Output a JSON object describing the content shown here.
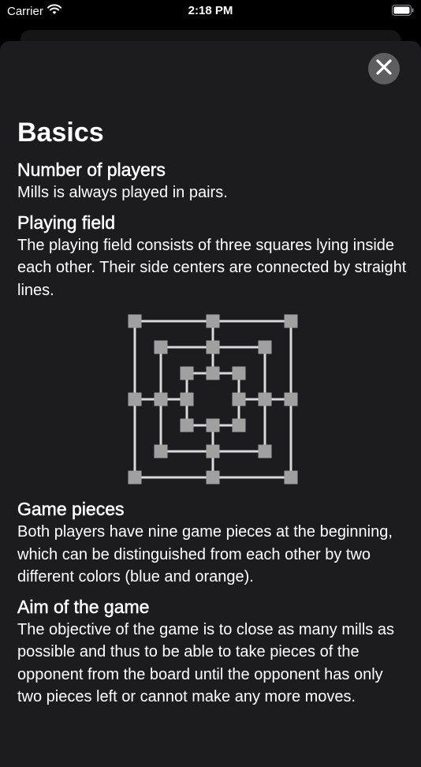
{
  "status_bar": {
    "carrier": "Carrier",
    "time": "2:18 PM"
  },
  "sheet": {
    "title": "Basics",
    "sections": [
      {
        "heading": "Number of players",
        "body": "Mills is always played in pairs."
      },
      {
        "heading": "Playing field",
        "body": "The playing field consists of three squares lying inside each other. Their side centers are connected by straight lines."
      },
      {
        "heading": "Game pieces",
        "body": "Both players have nine game pieces at the beginning, which can be distinguished from each other by two different colors (blue and orange)."
      },
      {
        "heading": "Aim of the game",
        "body": "The objective of the game is to close as many mills as possible and thus to be able to take pieces of the opponent from the board until the opponent has only two pieces left or cannot make any more moves."
      }
    ]
  },
  "colors": {
    "background": "#000000",
    "sheet": "#1c1c1e",
    "close_button": "#5e5e61",
    "board_line": "#d9d9d9",
    "board_point": "#a0a0a0"
  },
  "icons": {
    "close": "close-icon",
    "wifi": "wifi-icon",
    "battery": "battery-icon"
  }
}
